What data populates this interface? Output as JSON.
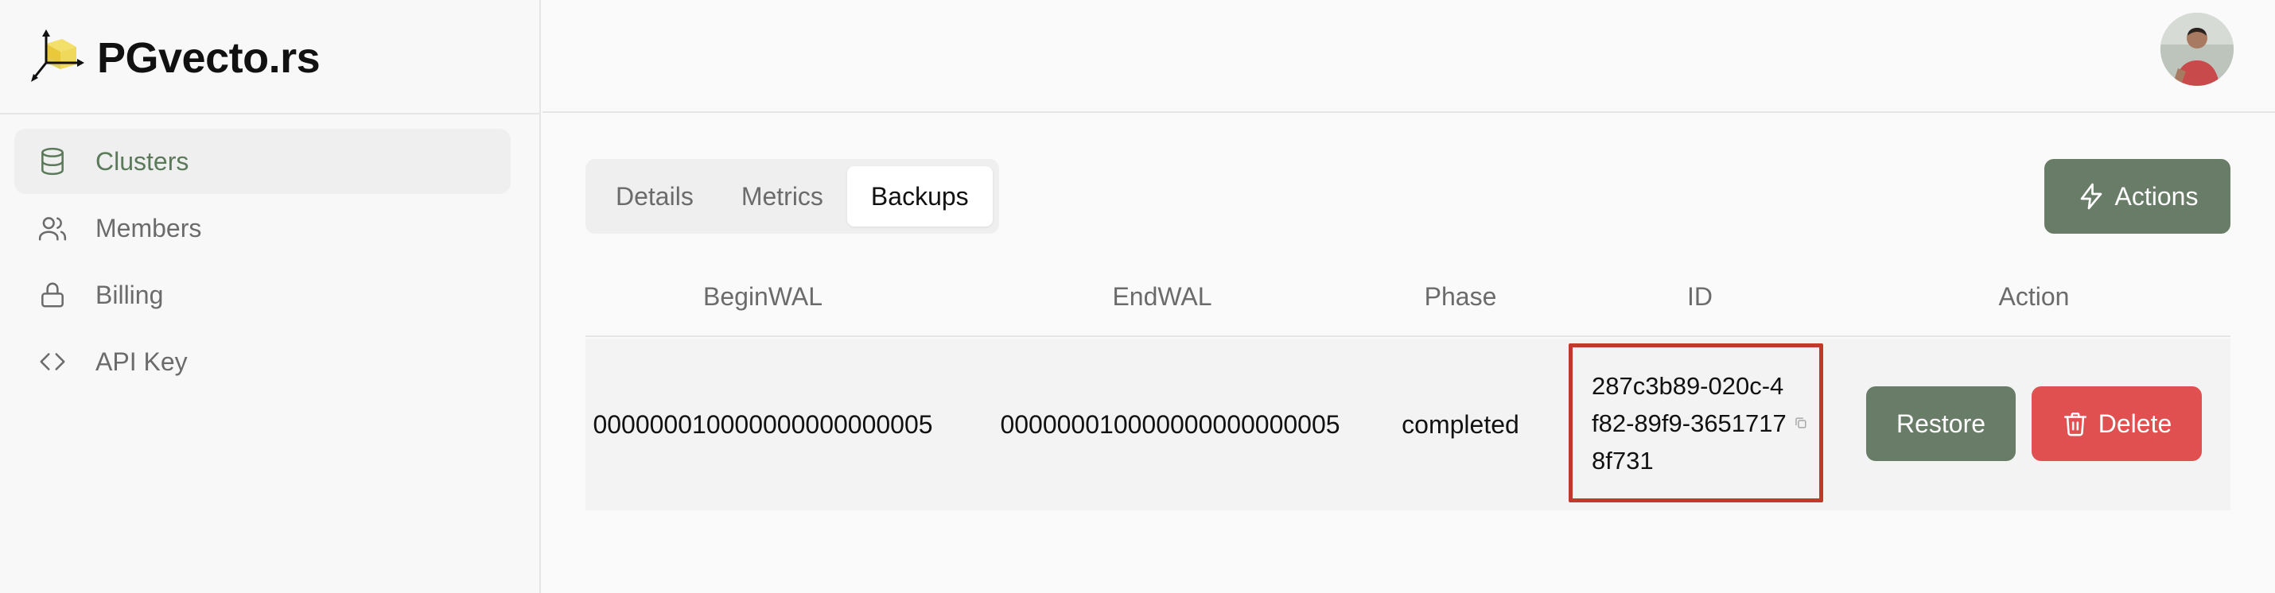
{
  "brand": {
    "name": "PGvecto.rs"
  },
  "sidebar": {
    "items": [
      {
        "label": "Clusters",
        "icon": "database-icon",
        "active": true
      },
      {
        "label": "Members",
        "icon": "users-icon",
        "active": false
      },
      {
        "label": "Billing",
        "icon": "lock-icon",
        "active": false
      },
      {
        "label": "API Key",
        "icon": "code-icon",
        "active": false
      }
    ]
  },
  "tabs": [
    {
      "label": "Details",
      "active": false
    },
    {
      "label": "Metrics",
      "active": false
    },
    {
      "label": "Backups",
      "active": true
    }
  ],
  "actions": {
    "label": "Actions",
    "icon": "zap-icon"
  },
  "table": {
    "columns": [
      "BeginWAL",
      "EndWAL",
      "Phase",
      "ID",
      "Action"
    ],
    "rows": [
      {
        "begin_wal": "000000010000000000000005",
        "end_wal": "000000010000000000000005",
        "phase": "completed",
        "id": "287c3b89-020c-4f82-89f9-36517178f731",
        "restore_label": "Restore",
        "delete_label": "Delete"
      }
    ]
  },
  "colors": {
    "accent": "#687c67",
    "danger": "#e05050",
    "highlight": "#c0392b",
    "active_nav_text": "#5a7a5a"
  }
}
